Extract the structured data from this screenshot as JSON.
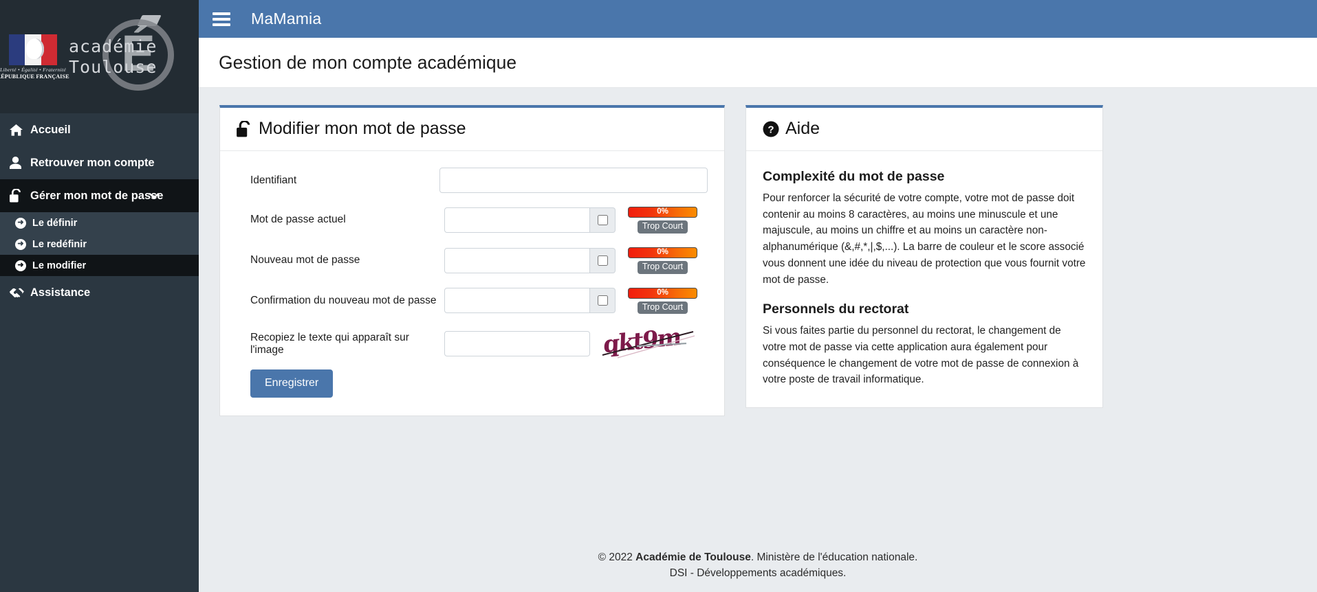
{
  "sidebar": {
    "brand": {
      "flag_motto": "Liberté • Égalité • Fraternité",
      "flag_republic": "RÉPUBLIQUE FRANÇAISE",
      "line1": "académie",
      "line2": "Toulouse",
      "monogram": "É"
    },
    "items": [
      {
        "label": "Accueil",
        "icon": "home-icon",
        "active": false
      },
      {
        "label": "Retrouver mon compte",
        "icon": "user-icon",
        "active": false
      },
      {
        "label": "Gérer mon mot de passe",
        "icon": "unlock-icon",
        "active": true,
        "chevron": "⌄"
      },
      {
        "label": "Assistance",
        "icon": "handshake-icon",
        "active": false
      }
    ],
    "submenu": [
      {
        "label": "Le définir",
        "icon": "arrow-circle-right-icon",
        "active": false
      },
      {
        "label": "Le redéfinir",
        "icon": "arrow-circle-right-icon",
        "active": false
      },
      {
        "label": "Le modifier",
        "icon": "arrow-circle-right-icon",
        "active": true
      }
    ]
  },
  "topbar": {
    "menu_icon": "hamburger-icon",
    "title": "MaMamia"
  },
  "page": {
    "title": "Gestion de mon compte académique"
  },
  "form_card": {
    "icon": "unlock-icon",
    "title": "Modifier mon mot de passe",
    "fields": [
      {
        "label": "Identifiant",
        "value": "",
        "placeholder": "",
        "type": "text",
        "has_toggle": false,
        "has_meter": false
      },
      {
        "label": "Mot de passe actuel",
        "value": "",
        "placeholder": "",
        "type": "password",
        "has_toggle": true,
        "has_meter": true
      },
      {
        "label": "Nouveau mot de passe",
        "value": "",
        "placeholder": "",
        "type": "password",
        "has_toggle": true,
        "has_meter": true
      },
      {
        "label": "Confirmation du nouveau mot de passe",
        "value": "",
        "placeholder": "",
        "type": "password",
        "has_toggle": true,
        "has_meter": true
      },
      {
        "label": "Recopiez le texte qui apparaît sur l'image",
        "value": "",
        "placeholder": "",
        "type": "text",
        "has_toggle": false,
        "has_meter": false
      }
    ],
    "strength": {
      "percent_label": "0%",
      "percent_value": 0,
      "status_label": "Trop Court",
      "bar_color_start": "#f21d0d",
      "bar_color_end": "#fb8c00",
      "badge_color": "#6c757d"
    },
    "captcha": {
      "text": "qkt9m",
      "color": "#7d1a4a"
    },
    "submit_label": "Enregistrer",
    "submit_color": "#4a76ab"
  },
  "help_card": {
    "icon": "question-circle-icon",
    "title": "Aide",
    "sections": [
      {
        "heading": "Complexité du mot de passe",
        "body": "Pour renforcer la sécurité de votre compte, votre mot de passe doit contenir au moins 8 caractères, au moins une minuscule et une majuscule, au moins un chiffre et au moins un caractère non-alphanumérique (&,#,*,|,$,...). La barre de couleur et le score associé vous donnent une idée du niveau de protection que vous fournit votre mot de passe."
      },
      {
        "heading": "Personnels du rectorat",
        "body": "Si vous faites partie du personnel du rectorat, le changement de votre mot de passe via cette application aura également pour conséquence le changement de votre mot de passe de connexion à votre poste de travail informatique."
      }
    ]
  },
  "footer": {
    "line1_prefix": "© 2022 ",
    "line1_strong": "Académie de Toulouse",
    "line1_suffix": ". Ministère de l'éducation nationale.",
    "line2": "DSI - Développements académiques."
  },
  "theme": {
    "accent": "#4a76ab",
    "sidebar_bg": "#2b3741",
    "sidebar_submenu_bg": "#34414c",
    "sidebar_active_bg": "#101417",
    "content_bg": "#e9ecef"
  }
}
